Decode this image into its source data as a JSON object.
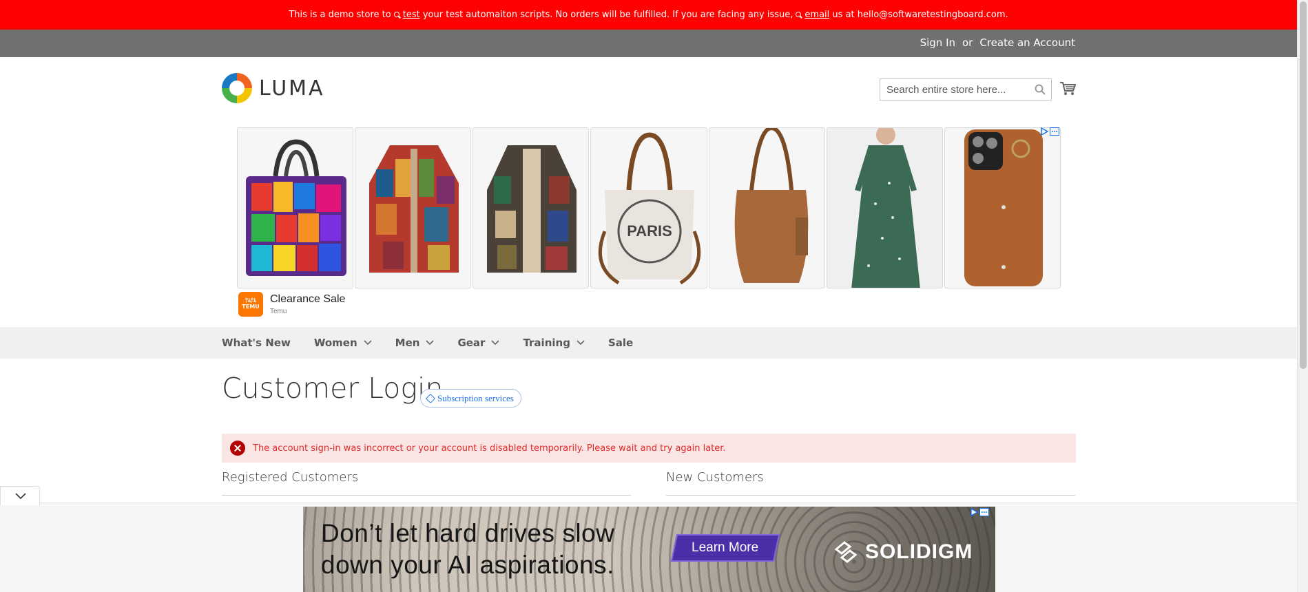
{
  "notice": {
    "pre": "This is a demo store to",
    "link1": "test",
    "mid": "your test automaiton scripts. No orders will be fulfilled. If you are facing any issue,",
    "link2": "email",
    "post": "us at hello@softwaretestingboard.com."
  },
  "account": {
    "sign_in": "Sign In",
    "or": "or",
    "create": "Create an Account"
  },
  "header": {
    "logo_text": "LUMA",
    "search_placeholder": "Search entire store here...",
    "search_icon": "search-icon",
    "cart_icon": "cart-icon"
  },
  "ad": {
    "title": "Clearance Sale",
    "advertiser": "Temu",
    "logo_lines": [
      "ﾃﾑﾃﾑ",
      "TEMU"
    ],
    "products": [
      "tote-bag",
      "patchwork-coat",
      "patchwork-hooded-coat",
      "paris-handbag",
      "brown-hobo-bag",
      "floral-dress",
      "phone-case"
    ]
  },
  "nav": {
    "items": [
      {
        "label": "What's New",
        "dropdown": false
      },
      {
        "label": "Women",
        "dropdown": true
      },
      {
        "label": "Men",
        "dropdown": true
      },
      {
        "label": "Gear",
        "dropdown": true
      },
      {
        "label": "Training",
        "dropdown": true
      },
      {
        "label": "Sale",
        "dropdown": false
      }
    ]
  },
  "page": {
    "title": "Customer Login",
    "badge": "Subscription services",
    "error": "The account sign-in was incorrect or your account is disabled temporarily. Please wait and try again later.",
    "registered_title": "Registered Customers",
    "new_title": "New Customers"
  },
  "bottom_ad": {
    "line1": "Don’t let hard drives slow",
    "line2": "down your AI aspirations.",
    "cta": "Learn More",
    "brand": "SOLIDIGM"
  },
  "colors": {
    "notice_bg": "#ff0101",
    "panel_bg": "#6e716e",
    "nav_bg": "#f0f0f0",
    "error_bg": "#fae5e5",
    "error_text": "#e02b27"
  }
}
